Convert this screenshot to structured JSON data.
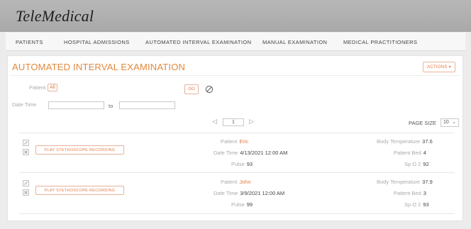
{
  "app": {
    "title": "TeleMedical"
  },
  "nav": {
    "items": [
      {
        "label": "PATIENTS"
      },
      {
        "label": "HOSPITAL ADMISSIONS"
      },
      {
        "label": "AUTOMATED INTERVAL EXAMINATION"
      },
      {
        "label": "MANUAL EXAMINATION"
      },
      {
        "label": "MEDICAL PRACTITIONERS"
      }
    ]
  },
  "panel": {
    "title": "AUTOMATED INTERVAL EXAMINATION",
    "actions_label": "ACTIONS ▾"
  },
  "filters": {
    "patient_label": "Patient",
    "patient_value": "All",
    "go_label": "GO",
    "datetime_label": "Date Time",
    "datetime_from": "",
    "datetime_to_label": "to",
    "datetime_to": ""
  },
  "pager": {
    "prev_icon": "◁",
    "page": "1",
    "next_icon": "▷",
    "page_size_label": "PAGE SIZE",
    "page_size_value": "10"
  },
  "records": [
    {
      "play_label": "PLAY STETHOSCOPE RECORDING",
      "patient_label": "Patient",
      "patient": "Eric",
      "datetime_label": "Date Time",
      "datetime": "4/13/2021 12:00 AM",
      "pulse_label": "Pulse",
      "pulse": "93",
      "temp_label": "Body Temperature",
      "temp": "37.6",
      "bed_label": "Patient Bed",
      "bed": "4",
      "spo2_label": "Sp O 2",
      "spo2": "92"
    },
    {
      "play_label": "PLAY STETHOSCOPE RECORDING",
      "patient_label": "Patient",
      "patient": "John",
      "datetime_label": "Date Time",
      "datetime": "3/9/2021 12:00 AM",
      "pulse_label": "Pulse",
      "pulse": "99",
      "temp_label": "Body Temperature",
      "temp": "37.9",
      "bed_label": "Patient Bed",
      "bed": "3",
      "spo2_label": "Sp O 2",
      "spo2": "93"
    }
  ],
  "colors": {
    "accent": "#e07a45",
    "header": "#b0b0b0"
  },
  "icons": {
    "edit": "pencil-icon",
    "delete": "close-icon",
    "clear": "clear-filter-icon"
  }
}
